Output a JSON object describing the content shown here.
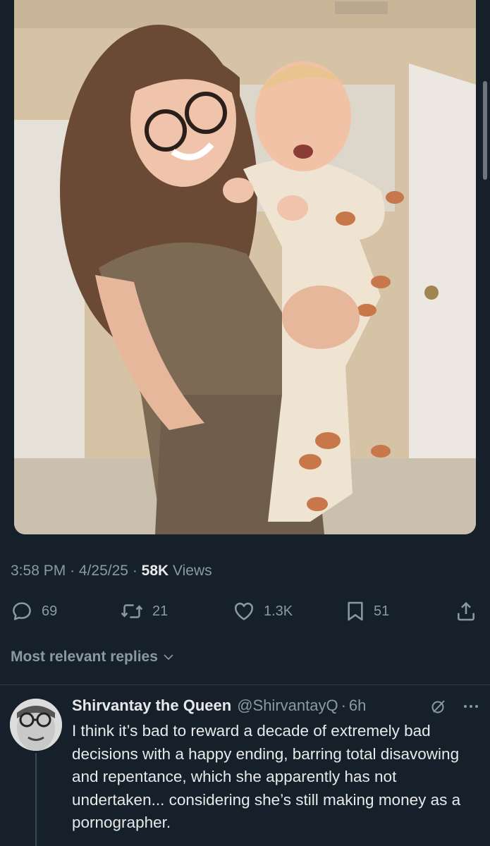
{
  "tweet": {
    "time": "3:58 PM",
    "date": "4/25/25",
    "views_count": "58K",
    "views_label": "Views",
    "stats": {
      "replies": "69",
      "reposts": "21",
      "likes": "1.3K",
      "bookmarks": "51"
    }
  },
  "replies_sort": {
    "label": "Most relevant replies"
  },
  "reply": {
    "name": "Shirvantay the Queen",
    "handle": "@ShirvantayQ",
    "separator": "·",
    "age": "6h",
    "text": "I think it’s bad to reward a decade of extremely bad decisions with a happy ending, barring total disavowing and repentance, which she apparently has not undertaken... considering she’s still making money as a pornographer."
  },
  "icons": {
    "reply": "reply-icon",
    "repost": "repost-icon",
    "like": "heart-icon",
    "bookmark": "bookmark-icon",
    "share": "share-icon",
    "grok": "grok-icon",
    "more": "more-icon",
    "chevron": "chevron-down-icon"
  },
  "colors": {
    "background": "#15202b",
    "text": "#e7e9ea",
    "secondary_text": "#8b98a5"
  }
}
